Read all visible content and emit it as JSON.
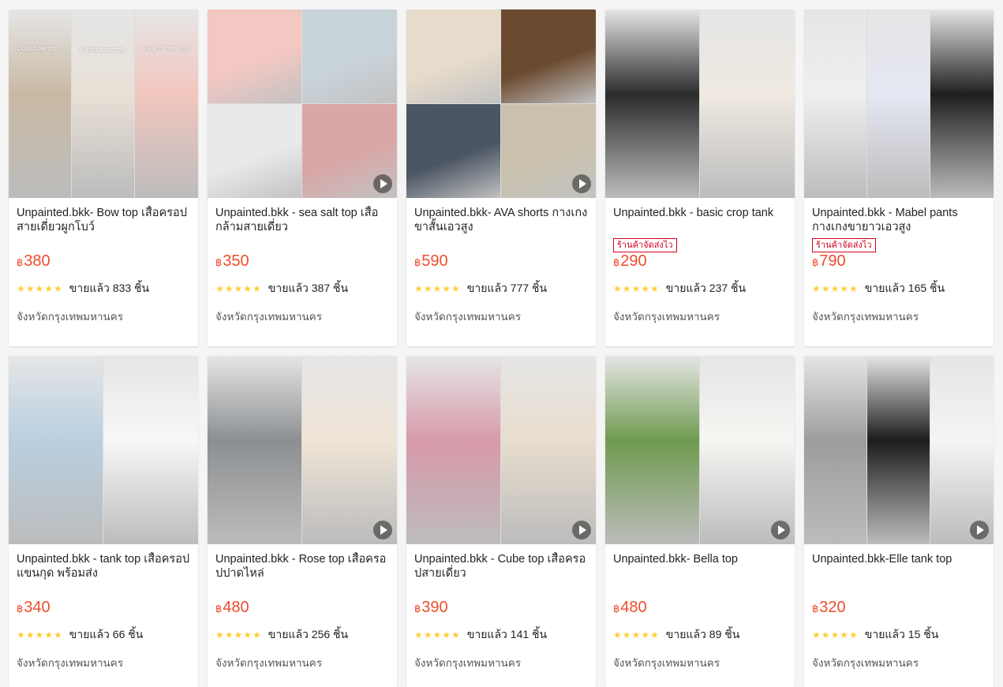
{
  "currency_symbol": "฿",
  "products": [
    {
      "title": "Unpainted.bkk- Bow top เสื้อครอปสายเดี่ยวผูกโบว์",
      "badge": "",
      "price": "380",
      "stars": "★★★★★",
      "sold": "ขายแล้ว 833 ชิ้น",
      "location": "จังหวัดกรุงเทพมหานคร",
      "video": false,
      "overlay_texts": [
        "Dust bow top",
        "White bow top",
        "Peach bow top"
      ],
      "colors": [
        "#c9b9a4",
        "#e8e0d6",
        "#f2c6bf"
      ]
    },
    {
      "title": "Unpainted.bkk - sea salt top เสื้อกล้ามสายเดี่ยว",
      "badge": "",
      "price": "350",
      "stars": "★★★★★",
      "sold": "ขายแล้ว 387 ชิ้น",
      "location": "จังหวัดกรุงเทพมหานคร",
      "video": true,
      "overlay_texts": [],
      "colors": [
        "#f3c7c2",
        "#c9d3da",
        "#e9e9e9",
        "#d9a7a7"
      ]
    },
    {
      "title": "Unpainted.bkk- AVA shorts กางเกงขาสั้นเอวสูง",
      "badge": "",
      "price": "590",
      "stars": "★★★★★",
      "sold": "ขายแล้ว 777 ชิ้น",
      "location": "จังหวัดกรุงเทพมหานคร",
      "video": true,
      "overlay_texts": [],
      "colors": [
        "#e7dccb",
        "#6b4a2f",
        "#4b5563",
        "#c9c1ad"
      ]
    },
    {
      "title": "Unpainted.bkk - basic crop tank",
      "badge": "ร้านค้าจัดส่งไว",
      "price": "290",
      "stars": "★★★★★",
      "sold": "ขายแล้ว 237 ชิ้น",
      "location": "จังหวัดกรุงเทพมหานคร",
      "video": false,
      "overlay_texts": [],
      "colors": [
        "#2b2b2b",
        "#efe9e1"
      ]
    },
    {
      "title": "Unpainted.bkk - Mabel pants กางเกงขายาวเอวสูง",
      "badge": "ร้านค้าจัดส่งไว",
      "price": "790",
      "stars": "★★★★★",
      "sold": "ขายแล้ว 165 ชิ้น",
      "location": "จังหวัดกรุงเทพมหานคร",
      "video": false,
      "overlay_texts": [],
      "colors": [
        "#efefef",
        "#e5e7f3",
        "#1f1f1f"
      ]
    },
    {
      "title": "Unpainted.bkk - tank top เสื้อครอปแขนกุด พร้อมส่ง",
      "badge": "",
      "price": "340",
      "stars": "★★★★★",
      "sold": "ขายแล้ว 66 ชิ้น",
      "location": "จังหวัดกรุงเทพมหานคร",
      "video": false,
      "overlay_texts": [],
      "colors": [
        "#b9cfe0",
        "#f7f7f7"
      ]
    },
    {
      "title": "Unpainted.bkk - Rose top เสื้อครอปปาดไหล่",
      "badge": "",
      "price": "480",
      "stars": "★★★★★",
      "sold": "ขายแล้ว 256 ชิ้น",
      "location": "จังหวัดกรุงเทพมหานคร",
      "video": true,
      "overlay_texts": [],
      "colors": [
        "#8c8f92",
        "#efe4d6"
      ]
    },
    {
      "title": "Unpainted.bkk - Cube top เสื้อครอปสายเดี่ยว",
      "badge": "",
      "price": "390",
      "stars": "★★★★★",
      "sold": "ขายแล้ว 141 ชิ้น",
      "location": "จังหวัดกรุงเทพมหานคร",
      "video": true,
      "overlay_texts": [],
      "colors": [
        "#d79aaa",
        "#e8ddce"
      ]
    },
    {
      "title": "Unpainted.bkk- Bella top",
      "badge": "",
      "price": "480",
      "stars": "★★★★★",
      "sold": "ขายแล้ว 89 ชิ้น",
      "location": "จังหวัดกรุงเทพมหานคร",
      "video": true,
      "overlay_texts": [],
      "colors": [
        "#6f9b4f",
        "#f5f5f2"
      ]
    },
    {
      "title": "Unpainted.bkk-Elle tank top",
      "badge": "",
      "price": "320",
      "stars": "★★★★★",
      "sold": "ขายแล้ว 15 ชิ้น",
      "location": "จังหวัดกรุงเทพมหานคร",
      "video": true,
      "overlay_texts": [],
      "colors": [
        "#9d9d9d",
        "#1c1c1c",
        "#f4f4f4"
      ]
    }
  ]
}
